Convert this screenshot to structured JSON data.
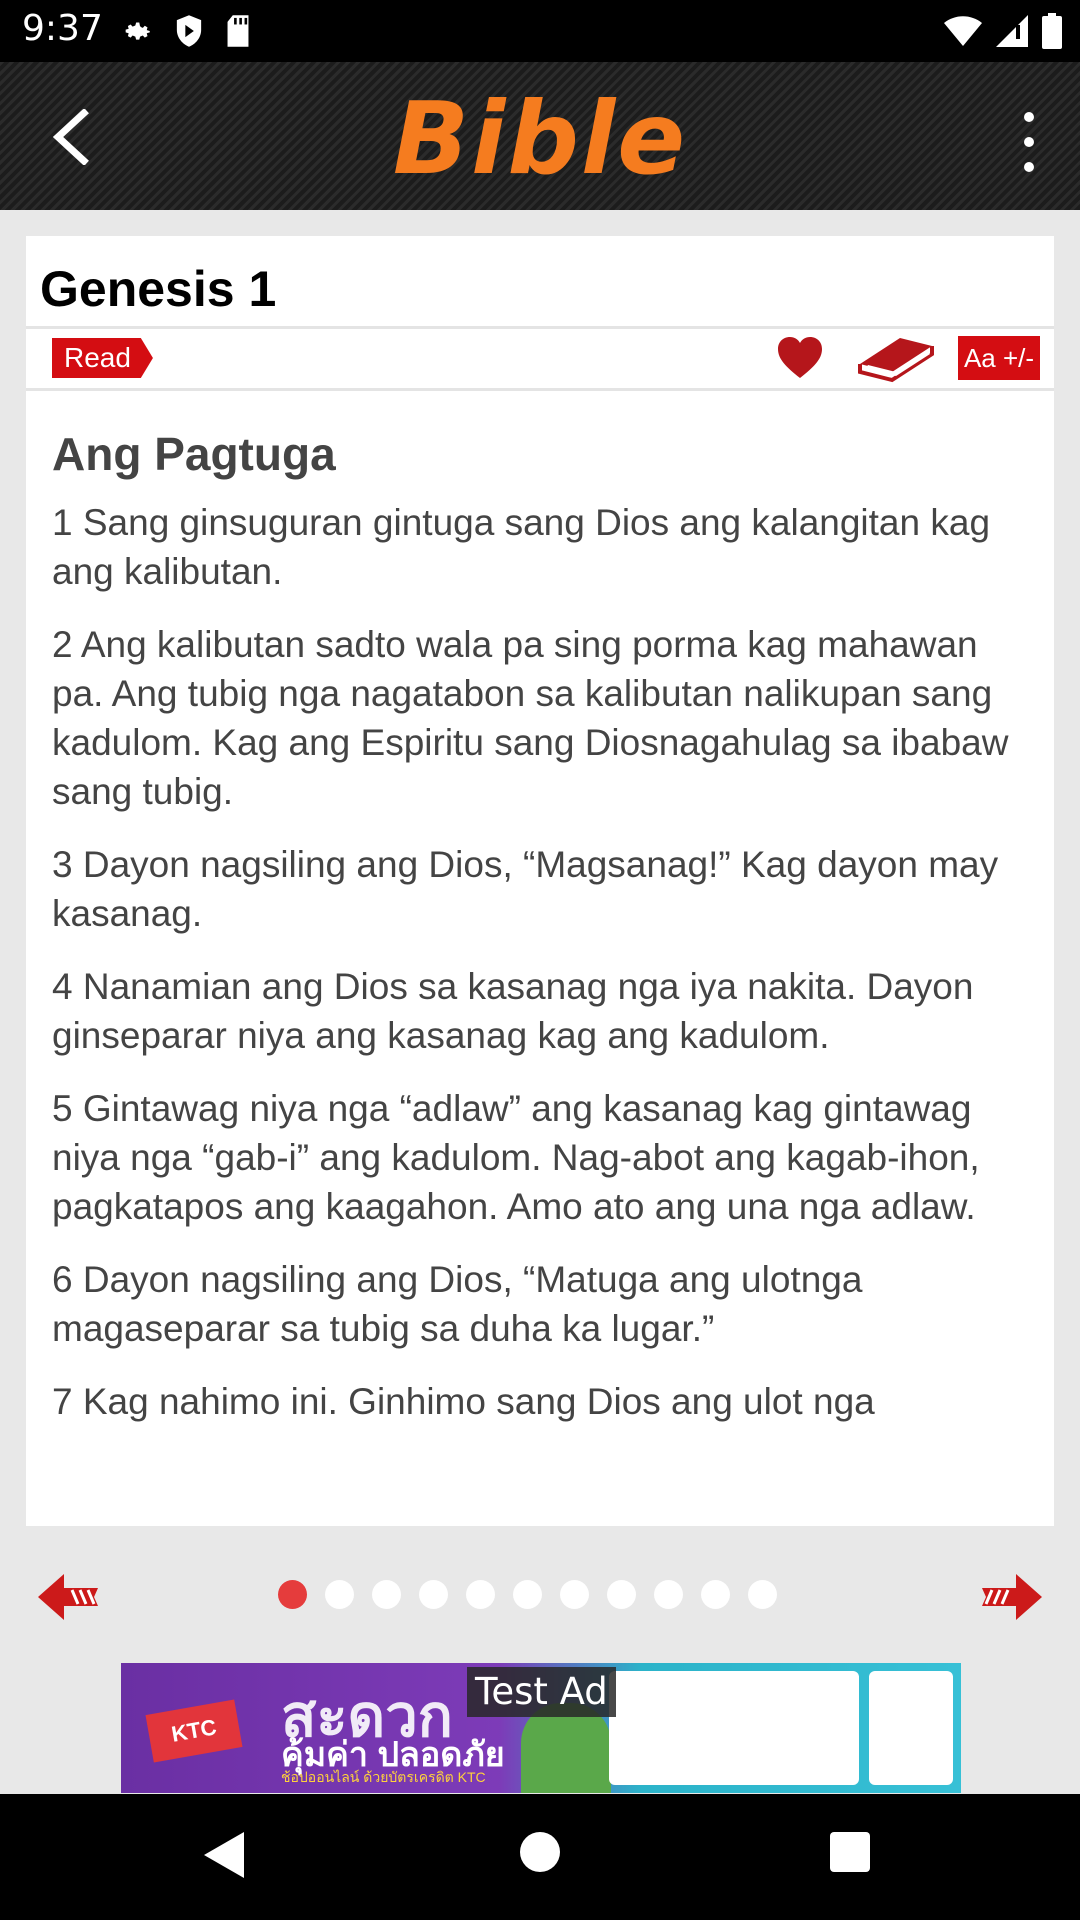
{
  "status_bar": {
    "time": "9:37",
    "left_icons": [
      "settings-icon",
      "play-protect-icon",
      "sd-card-icon"
    ],
    "right_icons": [
      "wifi-icon",
      "cell-signal-icon",
      "battery-icon"
    ]
  },
  "header": {
    "title": "Bible",
    "title_color": "#f57c1f",
    "back_icon": "back-arrow-icon",
    "menu_icon": "overflow-menu-icon"
  },
  "chapter": {
    "title": "Genesis 1",
    "read_label": "Read",
    "favorite_icon": "heart-icon",
    "bookmark_icon": "book-icon",
    "font_size_label": "Aa +/-",
    "accent": "#d40d12"
  },
  "content": {
    "section_heading": "Ang Pagtuga",
    "verses": [
      "1 Sang ginsuguran gintuga sang Dios ang kalangitan kag ang kalibutan.",
      "2 Ang kalibutan sadto wala pa sing porma kag mahawan pa. Ang tubig nga nagatabon sa kalibutan nalikupan sang kadulom. Kag ang Espiritu sang Diosnagahulag sa ibabaw sang tubig.",
      "3 Dayon nagsiling ang Dios, “Magsanag!” Kag dayon may kasanag.",
      "4 Nanamian ang Dios sa kasanag nga iya nakita. Dayon ginseparar niya ang kasanag kag ang kadulom.",
      "5 Gintawag niya nga “adlaw” ang kasanag kag gintawag niya nga “gab-i” ang kadulom. Nag-abot ang kagab-ihon, pagkatapos ang kaagahon. Amo ato ang una nga adlaw.",
      "6 Dayon nagsiling ang Dios, “Matuga ang ulotnga magaseparar sa tubig sa duha ka lugar.”",
      "7 Kag nahimo ini. Ginhimo sang Dios ang ulot nga"
    ]
  },
  "pager": {
    "prev_icon": "prev-arrow-icon",
    "next_icon": "next-arrow-icon",
    "page_count": 11,
    "active_page": 1,
    "active_color": "#e53c3c"
  },
  "ad": {
    "label": "Test Ad",
    "logo_text": "KTC",
    "headline": "สะดวก",
    "subline": "คุ้มค่า ปลอดภัย",
    "fineprint": "ช้อปออนไลน์ ด้วยบัตรเครดิต KTC"
  },
  "nav_bar": {
    "icons": [
      "nav-back-icon",
      "nav-home-icon",
      "nav-recents-icon"
    ]
  }
}
